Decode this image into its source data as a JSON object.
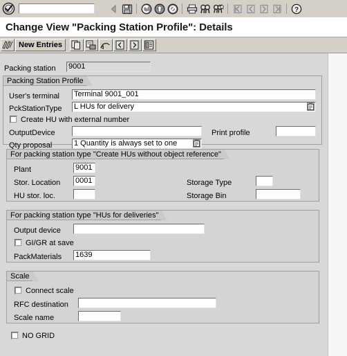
{
  "command_bar": {
    "command_field_value": "",
    "command_field_placeholder": "",
    "icons": [
      {
        "name": "back-arrow-icon",
        "label": "Back"
      },
      {
        "name": "save-icon",
        "label": "Save"
      },
      {
        "name": "back-green-icon",
        "label": "Back"
      },
      {
        "name": "exit-green-icon",
        "label": "Exit"
      },
      {
        "name": "cancel-icon",
        "label": "Cancel"
      },
      {
        "name": "print-icon",
        "label": "Print"
      },
      {
        "name": "find-icon",
        "label": "Find"
      },
      {
        "name": "find-next-icon",
        "label": "Find Next"
      },
      {
        "name": "first-page-icon",
        "label": "First Page"
      },
      {
        "name": "previous-page-icon",
        "label": "Previous Page"
      },
      {
        "name": "next-page-icon",
        "label": "Next Page"
      },
      {
        "name": "last-page-icon",
        "label": "Last Page"
      },
      {
        "name": "help-icon",
        "label": "Help"
      }
    ]
  },
  "title": "Change View \"Packing Station Profile\": Details",
  "app_toolbar": {
    "buttons": [
      {
        "name": "display-change-button",
        "label": "",
        "icon": "display-change-icon"
      },
      {
        "name": "new-entries-button",
        "label": "New Entries",
        "icon": ""
      },
      {
        "name": "copy-as-button",
        "label": "",
        "icon": "copy-icon"
      },
      {
        "name": "delete-button",
        "label": "",
        "icon": "delete-icon"
      },
      {
        "name": "undo-button",
        "label": "",
        "icon": "undo-icon"
      },
      {
        "name": "previous-entry-button",
        "label": "",
        "icon": "previous-entry-icon"
      },
      {
        "name": "next-entry-button",
        "label": "",
        "icon": "next-entry-icon"
      },
      {
        "name": "details-button",
        "label": "",
        "icon": "details-icon"
      }
    ]
  },
  "form": {
    "packing_station": {
      "label": "Packing station",
      "value": "9001"
    },
    "profile_group": {
      "title": "Packing Station Profile",
      "users_terminal": {
        "label": "User's terminal",
        "value": "Terminal 9001_001"
      },
      "pck_station_type": {
        "label": "PckStationType",
        "value": "L   HUs for delivery",
        "has_dropdown": true
      },
      "create_hu_external": {
        "label": "Create HU with external number",
        "checked": false
      },
      "output_device": {
        "label": "OutputDevice",
        "value": ""
      },
      "print_profile": {
        "label": "Print profile",
        "value": ""
      },
      "qty_proposal": {
        "label": "Qty proposal",
        "value": "1   Quantity is always set to one",
        "has_dropdown": true
      }
    },
    "create_hus_group": {
      "title": "For packing station type \"Create HUs without object reference\"",
      "plant": {
        "label": "Plant",
        "value": "9001"
      },
      "stor_location": {
        "label": "Stor. Location",
        "value": "0001"
      },
      "hu_stor_loc": {
        "label": "HU stor. loc.",
        "value": ""
      },
      "storage_type": {
        "label": "Storage Type",
        "value": ""
      },
      "storage_bin": {
        "label": "Storage Bin",
        "value": ""
      }
    },
    "hus_deliveries_group": {
      "title": "For packing station type \"HUs for deliveries\"",
      "output_device": {
        "label": "Output device",
        "value": ""
      },
      "gi_gr_at_save": {
        "label": "GI/GR at save",
        "checked": false
      },
      "pack_materials": {
        "label": "PackMaterials",
        "value": "1639"
      }
    },
    "scale_group": {
      "title": "Scale",
      "connect_scale": {
        "label": "Connect scale",
        "checked": false
      },
      "rfc_destination": {
        "label": "RFC destination",
        "value": ""
      },
      "scale_name": {
        "label": "Scale name",
        "value": ""
      }
    },
    "no_grid": {
      "label": "NO GRID",
      "checked": false
    }
  },
  "colors": {
    "toolbar_bg": "#d4d0c8",
    "sheet_bg": "#d8d8d8",
    "group_bg": "#d4d4d4",
    "group_header_bg": "#cacaca",
    "border": "#9e9e9e",
    "field_bg": "#ffffff",
    "field_key_bg": "#dadada"
  }
}
